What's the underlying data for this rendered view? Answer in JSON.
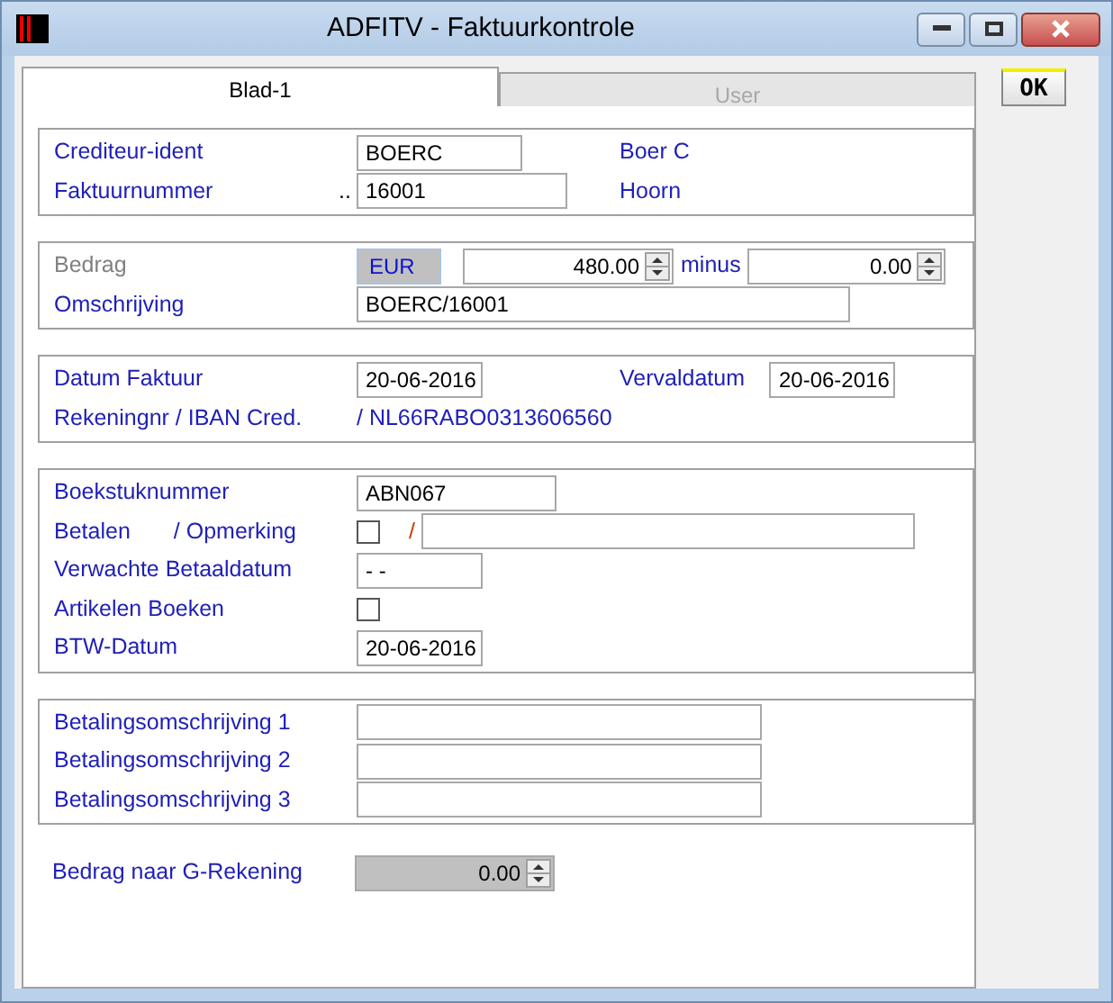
{
  "window": {
    "title": "ADFITV - Faktuurkontrole"
  },
  "tabs": [
    {
      "label": "Blad-1",
      "selected": true
    },
    {
      "label": "User",
      "selected": false
    }
  ],
  "ok_button": "OK",
  "sections": [
    {
      "bordered": true,
      "rows": [
        {
          "labels": [
            "Crediteur-ident"
          ],
          "disabled": false,
          "items": [
            {
              "kind": "field",
              "value": "BOERC"
            },
            {
              "kind": "info",
              "text": "Boer C"
            }
          ]
        },
        {
          "labels": [
            "Faktuurnummer"
          ],
          "disabled": false,
          "items": [
            {
              "kind": "prefix",
              "text": ".."
            },
            {
              "kind": "field",
              "value": "16001"
            },
            {
              "kind": "info",
              "text": "Hoorn"
            }
          ]
        }
      ]
    },
    {
      "bordered": true,
      "rows": [
        {
          "labels": [
            "Bedrag"
          ],
          "disabled": true,
          "items": [
            {
              "kind": "currency",
              "value": "EUR"
            },
            {
              "kind": "spin",
              "value": "480.00",
              "readonly": false
            },
            {
              "kind": "word",
              "text": "minus"
            },
            {
              "kind": "spin",
              "value": "0.00",
              "readonly": false
            }
          ]
        },
        {
          "labels": [
            "Omschrijving"
          ],
          "disabled": false,
          "items": [
            {
              "kind": "field",
              "value": "BOERC/16001"
            }
          ]
        }
      ]
    },
    {
      "bordered": true,
      "rows": [
        {
          "labels": [
            "Datum Faktuur"
          ],
          "disabled": false,
          "items": [
            {
              "kind": "field",
              "value": "20-06-2016"
            },
            {
              "kind": "info",
              "text": "Vervaldatum"
            },
            {
              "kind": "field",
              "value": "20-06-2016"
            }
          ]
        },
        {
          "labels": [
            "Rekeningnr / IBAN Cred."
          ],
          "disabled": false,
          "items": [
            {
              "kind": "word",
              "text": "/ NL66RABO0313606560"
            }
          ]
        }
      ]
    },
    {
      "bordered": true,
      "rows": [
        {
          "labels": [
            "Boekstuknummer"
          ],
          "disabled": false,
          "items": [
            {
              "kind": "field",
              "value": "ABN067"
            }
          ]
        },
        {
          "labels": [
            "Betalen",
            "/ Opmerking"
          ],
          "disabled": false,
          "items": [
            {
              "kind": "checkbox",
              "checked": false
            },
            {
              "kind": "slash",
              "text": "/"
            },
            {
              "kind": "field",
              "value": ""
            }
          ]
        },
        {
          "labels": [
            "Verwachte Betaaldatum"
          ],
          "disabled": false,
          "items": [
            {
              "kind": "field",
              "value": "- -"
            }
          ]
        },
        {
          "labels": [
            "Artikelen Boeken"
          ],
          "disabled": false,
          "items": [
            {
              "kind": "checkbox",
              "checked": false
            }
          ]
        },
        {
          "labels": [
            "BTW-Datum"
          ],
          "disabled": false,
          "items": [
            {
              "kind": "field",
              "value": "20-06-2016"
            }
          ]
        }
      ]
    },
    {
      "bordered": true,
      "rows": [
        {
          "labels": [
            "Betalingsomschrijving 1"
          ],
          "disabled": false,
          "items": [
            {
              "kind": "field",
              "value": ""
            }
          ]
        },
        {
          "labels": [
            "Betalingsomschrijving 2"
          ],
          "disabled": false,
          "items": [
            {
              "kind": "field",
              "value": ""
            }
          ]
        },
        {
          "labels": [
            "Betalingsomschrijving 3"
          ],
          "disabled": false,
          "items": [
            {
              "kind": "field",
              "value": ""
            }
          ]
        }
      ]
    },
    {
      "bordered": false,
      "rows": [
        {
          "labels": [
            "Bedrag naar G-Rekening"
          ],
          "disabled": false,
          "items": [
            {
              "kind": "spin",
              "value": "0.00",
              "readonly": true
            }
          ]
        }
      ]
    }
  ]
}
